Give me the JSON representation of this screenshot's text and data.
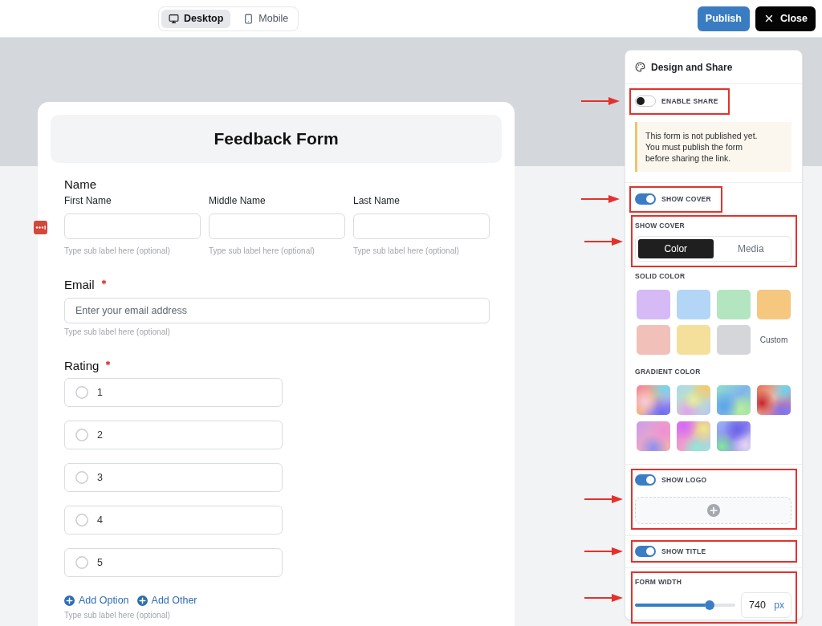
{
  "toolbar": {
    "views": [
      {
        "label": "Desktop",
        "selected": true
      },
      {
        "label": "Mobile",
        "selected": false
      }
    ],
    "buttons": [
      {
        "label": "Publish",
        "kind": "publish"
      },
      {
        "label": "Close",
        "kind": "close"
      }
    ]
  },
  "form": {
    "title": "Feedback Form",
    "fields": [
      {
        "kind": "name",
        "label": "Name",
        "parts": [
          {
            "label": "First Name",
            "hint": "Type sub label here (optional)"
          },
          {
            "label": "Middle Name",
            "hint": "Type sub label here (optional)"
          },
          {
            "label": "Last Name",
            "hint": "Type sub label here (optional)"
          }
        ]
      },
      {
        "kind": "email",
        "label": "Email",
        "required": true,
        "placeholder": "Enter your email address",
        "hint": "Type sub label here (optional)"
      },
      {
        "kind": "choice",
        "label": "Rating",
        "required": true,
        "options": [
          {
            "label": "1",
            "selected": false
          },
          {
            "label": "2",
            "selected": false
          },
          {
            "label": "3",
            "selected": false
          },
          {
            "label": "4",
            "selected": false
          },
          {
            "label": "5",
            "selected": false
          }
        ],
        "actions": [
          "Add Option",
          "Add Other"
        ],
        "hint": "Type sub label here (optional)"
      }
    ]
  },
  "panel": {
    "title": "Design and Share",
    "sections": [
      {
        "kind": "share",
        "toggle": {
          "label": "ENABLE SHARE",
          "on": false,
          "highlighted": true
        },
        "notice": "This form is not published yet. You must publish the form before sharing the link."
      },
      {
        "kind": "cover",
        "toggle": {
          "label": "SHOW COVER",
          "on": true,
          "highlighted": true
        },
        "cover_type": {
          "label": "SHOW COVER",
          "highlighted": true,
          "options": [
            {
              "label": "Color",
              "selected": true
            },
            {
              "label": "Media",
              "selected": false
            }
          ]
        },
        "solid": {
          "label": "SOLID COLOR",
          "swatches": [
            {
              "color": "#d5baf6"
            },
            {
              "color": "#b4d6f6"
            },
            {
              "color": "#b3e5c0"
            },
            {
              "color": "#f5c77f"
            },
            {
              "color": "#f0c0b9"
            },
            {
              "color": "#f5e09b"
            },
            {
              "color": "#d4d6da"
            }
          ],
          "custom": "Custom"
        },
        "gradient": {
          "label": "GRADIENT COLOR"
        }
      },
      {
        "kind": "logo",
        "toggle": {
          "label": "SHOW LOGO",
          "on": true
        },
        "highlighted": true
      },
      {
        "kind": "title",
        "toggle": {
          "label": "SHOW TITLE",
          "on": true
        },
        "highlighted": true
      },
      {
        "kind": "width",
        "label": "FORM WIDTH",
        "level": 0.74,
        "value": "740",
        "unit": "px",
        "highlighted": true
      }
    ]
  }
}
